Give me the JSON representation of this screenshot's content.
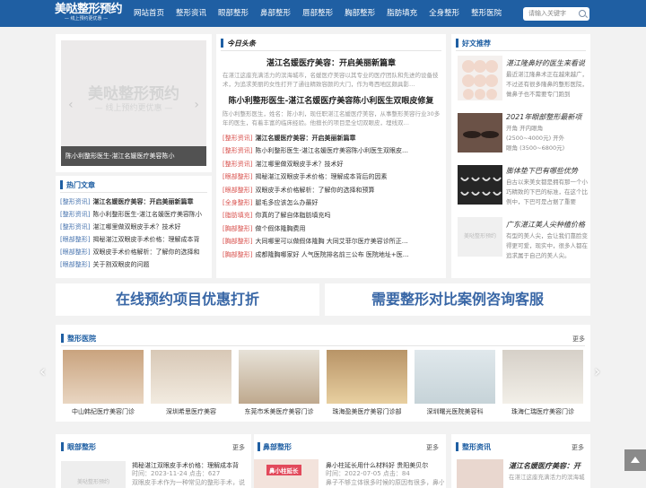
{
  "header": {
    "logo_title": "美哒整形预约",
    "logo_sub": "— 线上预约更优惠 —",
    "nav": [
      "网站首页",
      "整形资讯",
      "眼部整形",
      "鼻部整形",
      "唇部整形",
      "胸部整形",
      "脂肪填充",
      "全身整形",
      "整形医院"
    ],
    "search_placeholder": "请输入关键字"
  },
  "slider": {
    "watermark_title": "美哒整形预约",
    "watermark_sub": "— 线上预约更优惠 —",
    "caption": "陈小利整形医生-湛江名媛医疗美容陈小"
  },
  "hot": {
    "title": "热门文章",
    "items": [
      {
        "tag": "[整形资讯]",
        "text": "湛江名媛医疗美容：开启美丽新篇章",
        "bold": true
      },
      {
        "tag": "[整形资讯]",
        "text": "陈小利整形医生-湛江名媛医疗美容陈小",
        "bold": false
      },
      {
        "tag": "[整形资讯]",
        "text": "湛江哪里做双眼皮手术？技术好",
        "bold": false
      },
      {
        "tag": "[眼部整形]",
        "text": "揭秘湛江双眼皮手术价格：理解成本背",
        "bold": false
      },
      {
        "tag": "[眼部整形]",
        "text": "双眼皮手术价格解析：了解你的选择和",
        "bold": false
      },
      {
        "tag": "[眼部整形]",
        "text": "关于割双眼皮的问题",
        "bold": false
      }
    ]
  },
  "today": {
    "title": "今日头条",
    "headline1": "湛江名媛医疗美容：开启美丽新篇章",
    "desc1": "在湛江这座充满活力的滨海城市，名媛医疗美容以其专业的医疗团队和先进的设备技术，为追求美丽的女性打开了通往精致容颜的大门，作为粤西地区颇具影…",
    "headline2": "陈小利整形医生-湛江名媛医疗美容陈小利医生双眼皮修复",
    "desc2": "陈小利整形医生，姓名：陈小利，现任职湛江名媛医疗美容，从事整形美容行业30多年的医生，有着丰富的临床经验。他擅长的项目是全切双眼皮，埋线双…",
    "list": [
      {
        "tag": "[整形资讯]",
        "text": "湛江名媛医疗美容：开启美丽新篇章",
        "bold": true
      },
      {
        "tag": "[整形资讯]",
        "text": "陈小利整形医生-湛江名媛医疗美容陈小利医生双眼皮…",
        "bold": false
      },
      {
        "tag": "[整形资讯]",
        "text": "湛江哪里做双眼皮手术？技术好",
        "bold": false
      },
      {
        "tag": "[眼部整形]",
        "text": "揭秘湛江双眼皮手术价格：理解成本背后的因素",
        "bold": false
      },
      {
        "tag": "[眼部整形]",
        "text": "双眼皮手术价格解析：了解你的选择和预算",
        "bold": false
      },
      {
        "tag": "[全身整形]",
        "text": "腿毛多应该怎么办最好",
        "bold": false
      },
      {
        "tag": "[脂肪填充]",
        "text": "你真的了解自体脂肪填充吗",
        "bold": false
      },
      {
        "tag": "[胸部整形]",
        "text": "做个假体隆胸费用",
        "bold": false
      },
      {
        "tag": "[胸部整形]",
        "text": "大同哪里可以做假体隆胸 大同艾菲尔医疗美容诊所正…",
        "bold": false
      },
      {
        "tag": "[胸部整形]",
        "text": "成都隆胸哪家好 人气医院排名前三公布 医院地址+医…",
        "bold": false
      }
    ]
  },
  "recommend": {
    "title": "好文推荐",
    "items": [
      {
        "title": "湛江隆鼻好的医生来看说",
        "text": "最近湛江隆鼻术正在越来越广，不过还有很多隆鼻的整形医院，做鼻子也不需要专门跑到"
      },
      {
        "title": "2021年眼部整形最新项",
        "text": "开角 开内眼角 (2500~4000元) 开外眼角 (3500~6800元) 做"
      },
      {
        "title": "膨体垫下巴有哪些优势",
        "text": "自古以来美女都是拥有那一个小巧精致的下巴的标准，在这个比例中，下巴可是占据了重要"
      },
      {
        "title": "广东湛江美人尖种植价格",
        "text": "有型的美人尖，会让我们靠脸变得更可爱，现实中，很多人都在追求属于自己的美人尖。"
      }
    ]
  },
  "banners": [
    "在线预约项目优惠打折",
    "需要整形对比案例咨询客服"
  ],
  "hospitals": {
    "title": "整形医院",
    "more": "更多",
    "names": [
      "中山韩纪医疗美容门诊",
      "深圳希思医疗美容",
      "东莞市禾美医疗美容门诊",
      "珠海盈美医疗美容门诊部",
      "深圳曙光医院美容科",
      "珠海仁瑞医疗美容门诊"
    ]
  },
  "bottom": {
    "eye": {
      "title": "眼部整形",
      "more": "更多",
      "item_title": "揭秘湛江双眼皮手术价格：理解成本背",
      "item_meta": "时间：2023-11-24 点击：627",
      "item_text": "双眼皮手术作为一种常见的整形手术，说"
    },
    "nose": {
      "title": "鼻部整形",
      "more": "更多",
      "item_title": "鼻小柱延长用什么材料好 贵阳美贝尔",
      "item_meta": "时间：2022-07-05 点击：84",
      "item_text": "鼻子不够立体很多时候的原因有很多，鼻小柱"
    },
    "news": {
      "title": "整形资讯",
      "more": "更多",
      "item_title": "湛江名媛医疗美容：开",
      "item_text": "在湛江这座充满活力的滨海城"
    },
    "thumb_text_nose": "鼻小柱延长"
  },
  "colors": {
    "brand": "#1f5fa3",
    "tag_blue": "#4a76b0",
    "tag_red": "#d9534f"
  }
}
